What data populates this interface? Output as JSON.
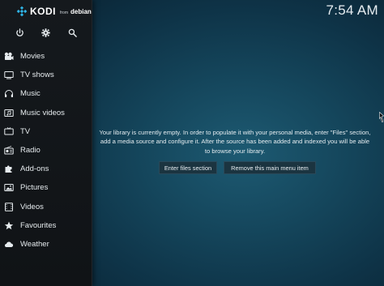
{
  "app": {
    "logo_text": "KODI",
    "logo_from": "from",
    "logo_debian": "debian"
  },
  "clock": "7:54 AM",
  "toolbar": {
    "power_icon": "power-icon",
    "settings_icon": "gear-icon",
    "search_icon": "search-icon"
  },
  "menu": {
    "items": [
      {
        "label": "Movies",
        "icon": "movies-icon"
      },
      {
        "label": "TV shows",
        "icon": "tv-shows-icon"
      },
      {
        "label": "Music",
        "icon": "headphones-icon"
      },
      {
        "label": "Music videos",
        "icon": "music-videos-icon"
      },
      {
        "label": "TV",
        "icon": "tv-icon"
      },
      {
        "label": "Radio",
        "icon": "radio-icon"
      },
      {
        "label": "Add-ons",
        "icon": "addons-icon"
      },
      {
        "label": "Pictures",
        "icon": "pictures-icon"
      },
      {
        "label": "Videos",
        "icon": "videos-icon"
      },
      {
        "label": "Favourites",
        "icon": "star-icon"
      },
      {
        "label": "Weather",
        "icon": "weather-icon"
      }
    ]
  },
  "main": {
    "message": "Your library is currently empty. In order to populate it with your personal media, enter \"Files\" section, add a media source and configure it. After the source has been added and indexed you will be able to browse your library.",
    "enter_files_label": "Enter files section",
    "remove_item_label": "Remove this main menu item"
  },
  "colors": {
    "sidebar_bg": "#15191d",
    "main_bg": "#15475d",
    "button_bg": "#1b3440",
    "text": "#e6ebee"
  }
}
